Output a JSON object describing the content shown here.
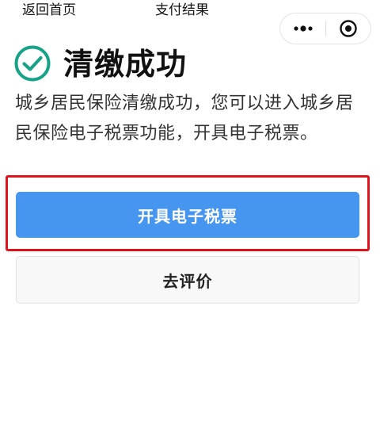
{
  "nav": {
    "back_label": "返回首页",
    "title": "支付结果"
  },
  "capsule": {
    "more_icon": "more-dots-icon",
    "close_icon": "target-close-icon"
  },
  "result": {
    "icon": "check-circle-icon",
    "heading": "清缴成功",
    "description": "城乡居民保险清缴成功，您可以进入城乡居民保险电子税票功能，开具电子税票。"
  },
  "actions": {
    "primary_label": "开具电子税票",
    "secondary_label": "去评价"
  },
  "colors": {
    "success": "#17a388",
    "primary": "#4696f0",
    "highlight_border": "#e0131c",
    "secondary_bg": "#f8f8f8"
  }
}
